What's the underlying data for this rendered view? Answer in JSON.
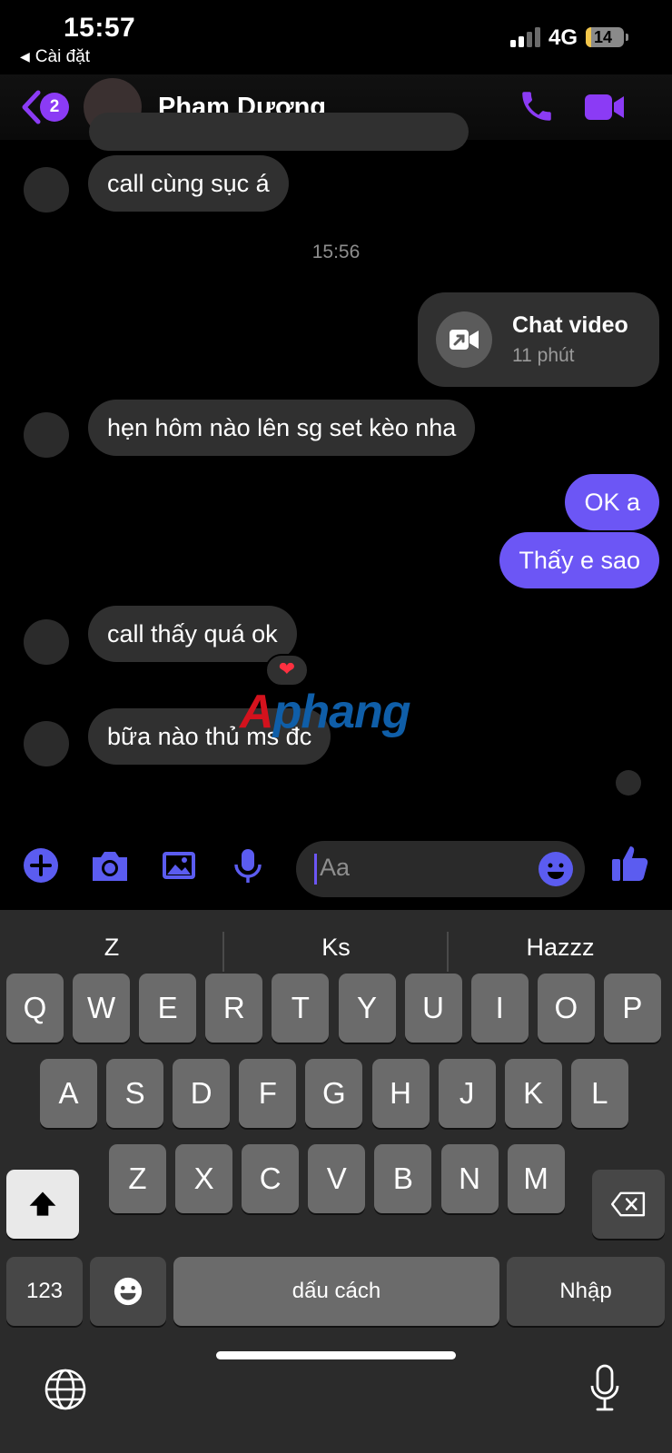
{
  "status_bar": {
    "time": "15:57",
    "back_app": "Cài đặt",
    "network": "4G",
    "battery_level": "14"
  },
  "header": {
    "back_badge": "2",
    "contact_name": "Phạm Dương",
    "call_icon": "phone-icon",
    "video_icon": "video-camera-icon"
  },
  "messages": {
    "m1": "call cùng sục á",
    "timestamp": "15:56",
    "video_call": {
      "title": "Chat video",
      "duration": "11 phút"
    },
    "m2": "hẹn hôm nào lên sg set kèo nha",
    "m3": "OK a",
    "m4": "Thấy e sao",
    "m5": "call thấy quá ok",
    "m5_reaction": "❤",
    "m6": "bữa nào thủ ms đc"
  },
  "watermark": {
    "part1": "A",
    "part2": "phang"
  },
  "composer": {
    "placeholder": "Aa",
    "tools": [
      "plus-icon",
      "camera-icon",
      "image-icon",
      "microphone-icon"
    ]
  },
  "keyboard": {
    "suggestions": [
      "Z",
      "Ks",
      "Hazzz"
    ],
    "row1": [
      "Q",
      "W",
      "E",
      "R",
      "T",
      "Y",
      "U",
      "I",
      "O",
      "P"
    ],
    "row2": [
      "A",
      "S",
      "D",
      "F",
      "G",
      "H",
      "J",
      "K",
      "L"
    ],
    "row3": [
      "Z",
      "X",
      "C",
      "V",
      "B",
      "N",
      "M"
    ],
    "numbers_key": "123",
    "space_key": "dấu cách",
    "return_key": "Nhập"
  },
  "colors": {
    "accent": "#8b3bf5",
    "outgoing_bubble": "#6c56f5",
    "incoming_bubble": "#303030",
    "tool_icon": "#5b5cf0"
  }
}
